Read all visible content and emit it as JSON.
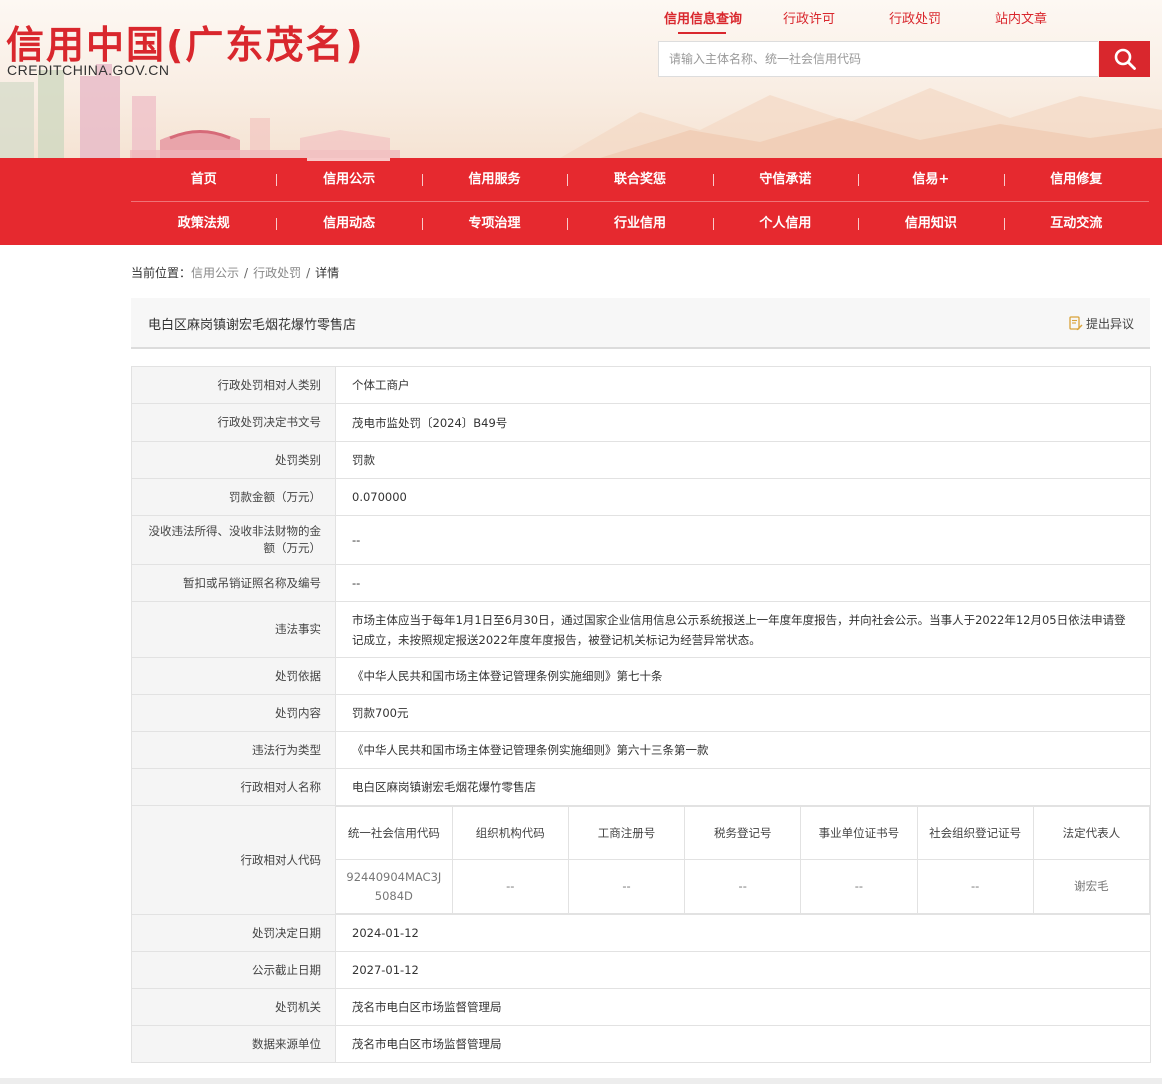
{
  "header": {
    "logo_cn": "信用中国(广东茂名)",
    "logo_en": "CREDITCHINA.GOV.CN",
    "top_links": [
      "信用信息查询",
      "行政许可",
      "行政处罚",
      "站内文章"
    ],
    "search_placeholder": "请输入主体名称、统一社会信用代码",
    "search_icon": "search-icon"
  },
  "nav": {
    "row1": [
      "首页",
      "信用公示",
      "信用服务",
      "联合奖惩",
      "守信承诺",
      "信易+",
      "信用修复"
    ],
    "row2": [
      "政策法规",
      "信用动态",
      "专项治理",
      "行业信用",
      "个人信用",
      "信用知识",
      "互动交流"
    ]
  },
  "breadcrumb": {
    "prefix": "当前位置：",
    "items": [
      "信用公示",
      "行政处罚"
    ],
    "sep": "/",
    "current": "详情"
  },
  "title": {
    "name": "电白区麻岗镇谢宏毛烟花爆竹零售店",
    "objection": "提出异议",
    "objection_icon": "document-edit-icon"
  },
  "details": [
    {
      "label": "行政处罚相对人类别",
      "value": "个体工商户"
    },
    {
      "label": "行政处罚决定书文号",
      "value": "茂电市监处罚〔2024〕B49号"
    },
    {
      "label": "处罚类别",
      "value": "罚款"
    },
    {
      "label": "罚款金额（万元）",
      "value": "0.070000"
    },
    {
      "label": "没收违法所得、没收非法财物的金额（万元）",
      "value": "--"
    },
    {
      "label": "暂扣或吊销证照名称及编号",
      "value": "--"
    },
    {
      "label": "违法事实",
      "value": "市场主体应当于每年1月1日至6月30日，通过国家企业信用信息公示系统报送上一年度年度报告，并向社会公示。当事人于2022年12月05日依法申请登记成立，未按照规定报送2022年度年度报告，被登记机关标记为经营异常状态。"
    },
    {
      "label": "处罚依据",
      "value": "《中华人民共和国市场主体登记管理条例实施细则》第七十条"
    },
    {
      "label": "处罚内容",
      "value": "罚款700元"
    },
    {
      "label": "违法行为类型",
      "value": "《中华人民共和国市场主体登记管理条例实施细则》第六十三条第一款"
    },
    {
      "label": "行政相对人名称",
      "value": "电白区麻岗镇谢宏毛烟花爆竹零售店"
    }
  ],
  "codes": {
    "label": "行政相对人代码",
    "headers": [
      "统一社会信用代码",
      "组织机构代码",
      "工商注册号",
      "税务登记号",
      "事业单位证书号",
      "社会组织登记证号",
      "法定代表人"
    ],
    "values": [
      "92440904MAC3J5084D",
      "--",
      "--",
      "--",
      "--",
      "--",
      "谢宏毛"
    ]
  },
  "details2": [
    {
      "label": "处罚决定日期",
      "value": "2024-01-12"
    },
    {
      "label": "公示截止日期",
      "value": "2027-01-12"
    },
    {
      "label": "处罚机关",
      "value": "茂名市电白区市场监督管理局"
    },
    {
      "label": "数据来源单位",
      "value": "茂名市电白区市场监督管理局"
    }
  ],
  "colors": {
    "brand_red": "#d9272d",
    "nav_red": "#e6292f"
  }
}
